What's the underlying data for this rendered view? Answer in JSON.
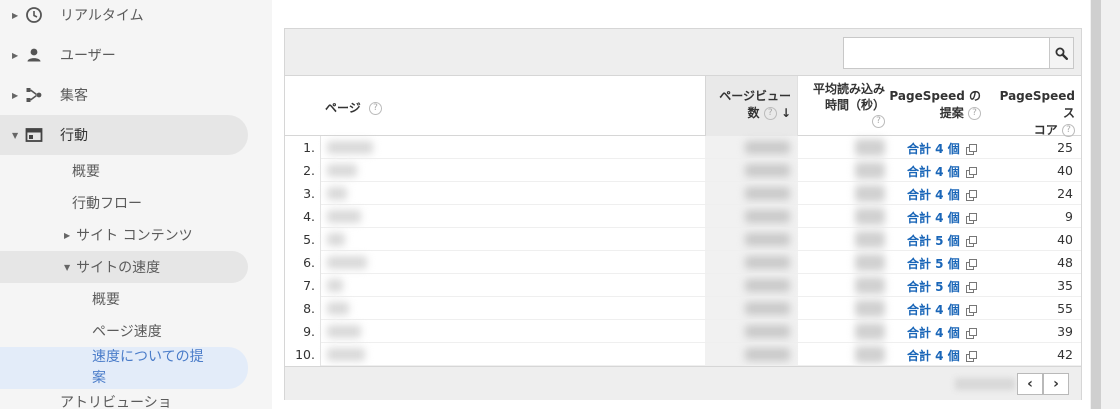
{
  "sidebar": {
    "top_items": [
      {
        "label": "リアルタイム",
        "icon": "clock-icon"
      },
      {
        "label": "ユーザー",
        "icon": "person-icon"
      },
      {
        "label": "集客",
        "icon": "acquisition-icon"
      },
      {
        "label": "行動",
        "icon": "behavior-icon"
      }
    ],
    "behavior_sub": {
      "overview": "概要",
      "flow": "行動フロー",
      "site_content": "サイト コンテンツ",
      "site_speed": "サイトの速度",
      "speed_overview": "概要",
      "page_timings": "ページ速度",
      "speed_suggestions_line1": "速度についての提",
      "speed_suggestions_line2": "案"
    },
    "attribution": "アトリビューショ"
  },
  "search": {
    "value": "",
    "placeholder": ""
  },
  "table": {
    "headers": {
      "page": "ページ",
      "pageviews_line1": "ページビュー",
      "pageviews_line2": "数",
      "load_time_line1": "平均読み込み",
      "load_time_line2": "時間（秒）",
      "suggestions_line1": "PageSpeed の",
      "suggestions_line2": "提案",
      "score_line1": "PageSpeed ス",
      "score_line2": "コア"
    },
    "rows": [
      {
        "num": "1.",
        "suggestions": "合計 4 個",
        "score": "25"
      },
      {
        "num": "2.",
        "suggestions": "合計 4 個",
        "score": "40"
      },
      {
        "num": "3.",
        "suggestions": "合計 4 個",
        "score": "24"
      },
      {
        "num": "4.",
        "suggestions": "合計 4 個",
        "score": "9"
      },
      {
        "num": "5.",
        "suggestions": "合計 5 個",
        "score": "40"
      },
      {
        "num": "6.",
        "suggestions": "合計 5 個",
        "score": "48"
      },
      {
        "num": "7.",
        "suggestions": "合計 5 個",
        "score": "35"
      },
      {
        "num": "8.",
        "suggestions": "合計 4 個",
        "score": "55"
      },
      {
        "num": "9.",
        "suggestions": "合計 4 個",
        "score": "39"
      },
      {
        "num": "10.",
        "suggestions": "合計 4 個",
        "score": "42"
      }
    ]
  },
  "pager": {
    "prev": "‹",
    "next": "›"
  },
  "colors": {
    "link": "#1a66b8",
    "selected_nav_text": "#4a7cc9",
    "selected_nav_bg": "#e3ecf9"
  }
}
